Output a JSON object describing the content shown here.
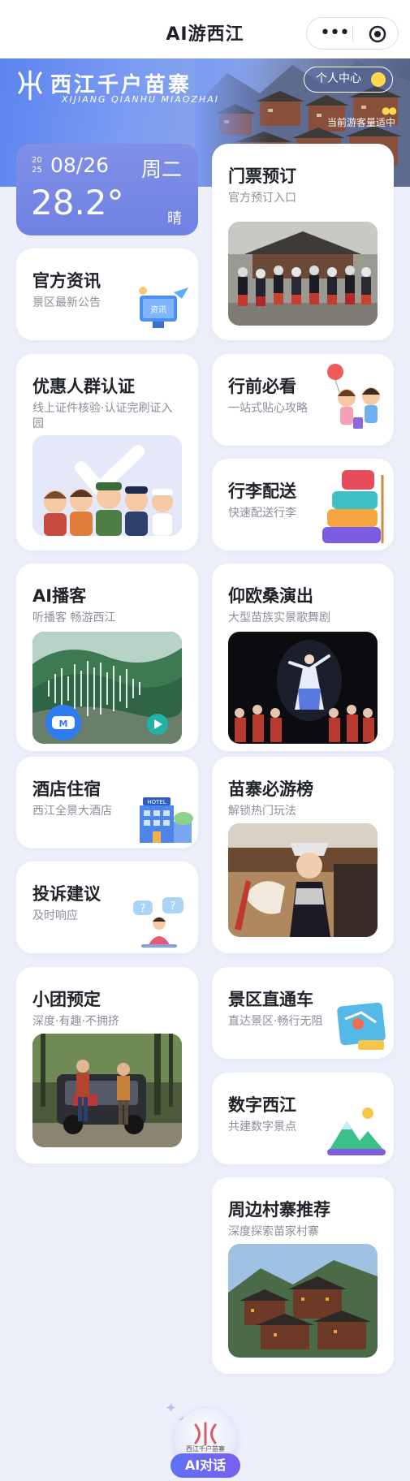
{
  "nav": {
    "title": "AI游西江",
    "more_icon": "more-dots-icon",
    "close_icon": "target-icon"
  },
  "banner": {
    "logo_text": "西江千户苗寨",
    "logo_sub": "XIJIANG QIANHU MIAOZHAI",
    "personal_center": "个人中心",
    "crowd_status": "当前游客量适中"
  },
  "weather": {
    "year": "2025",
    "date": "08/26",
    "weekday": "周二",
    "temperature": "28.2°",
    "condition": "晴"
  },
  "cards": {
    "tickets": {
      "title": "门票预订",
      "subtitle": "官方预订入口"
    },
    "news": {
      "title": "官方资讯",
      "subtitle": "景区最新公告",
      "badge": "资讯"
    },
    "discount": {
      "title": "优惠人群认证",
      "subtitle": "线上证件核验·认证完刷证入园"
    },
    "prepare": {
      "title": "行前必看",
      "subtitle": "一站式贴心攻略"
    },
    "luggage": {
      "title": "行李配送",
      "subtitle": "快速配送行李"
    },
    "podcast": {
      "title": "AI播客",
      "subtitle": "听播客 畅游西江"
    },
    "show": {
      "title": "仰欧桑演出",
      "subtitle": "大型苗族实景歌舞剧"
    },
    "hotel": {
      "title": "酒店住宿",
      "subtitle": "西江全景大酒店",
      "sign": "HOTEL"
    },
    "ranking": {
      "title": "苗寨必游榜",
      "subtitle": "解锁热门玩法"
    },
    "complaint": {
      "title": "投诉建议",
      "subtitle": "及时响应"
    },
    "group": {
      "title": "小团预定",
      "subtitle": "深度·有趣·不拥挤"
    },
    "shuttle": {
      "title": "景区直通车",
      "subtitle": "直达景区·畅行无阻"
    },
    "digital": {
      "title": "数字西江",
      "subtitle": "共建数字景点"
    },
    "villages": {
      "title": "周边村寨推荐",
      "subtitle": "深度探索苗家村寨"
    }
  },
  "ai": {
    "orb_text": "西江千户苗寨",
    "button_label": "AI对话"
  },
  "colors": {
    "accent": "#6f81e2",
    "background": "#edf0fb",
    "ai_button": "#6a68f1"
  }
}
